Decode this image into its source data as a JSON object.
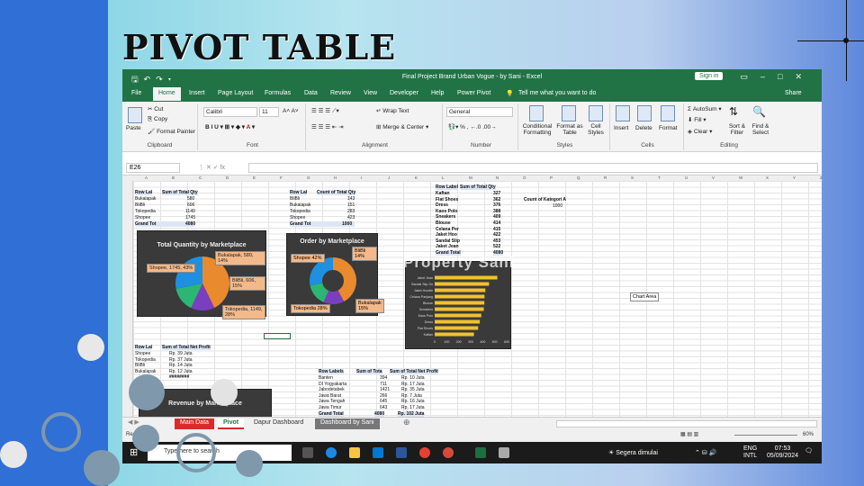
{
  "slide": {
    "title": "PIVOT TABLE",
    "watermark": "Property Sani"
  },
  "window": {
    "title": "Final Project Brand Urban Vogue - by Sani  -  Excel",
    "sign_in": "Sign in",
    "share": "Share"
  },
  "tabs": [
    "File",
    "Home",
    "Insert",
    "Page Layout",
    "Formulas",
    "Data",
    "Review",
    "View",
    "Developer",
    "Help",
    "Power Pivot"
  ],
  "tell_me": "Tell me what you want to do",
  "ribbon": {
    "clipboard": {
      "label": "Clipboard",
      "paste": "Paste",
      "cut": "Cut",
      "copy": "Copy",
      "format_painter": "Format Painter"
    },
    "font": {
      "label": "Font",
      "name": "Calibri",
      "size": "11"
    },
    "alignment": {
      "label": "Alignment",
      "wrap": "Wrap Text",
      "merge": "Merge & Center"
    },
    "number": {
      "label": "Number",
      "format": "General"
    },
    "styles": {
      "label": "Styles",
      "conditional": "Conditional Formatting",
      "format_table": "Format as Table",
      "cell_styles": "Cell Styles"
    },
    "cells": {
      "label": "Cells",
      "insert": "Insert",
      "delete": "Delete",
      "format": "Format"
    },
    "editing": {
      "label": "Editing",
      "autosum": "AutoSum",
      "fill": "Fill",
      "clear": "Clear",
      "sort": "Sort & Filter",
      "find": "Find & Select"
    }
  },
  "name_box": "E26",
  "columns": [
    "A",
    "B",
    "C",
    "D",
    "E",
    "F",
    "G",
    "H",
    "I",
    "J",
    "K",
    "L",
    "M",
    "N",
    "O",
    "P",
    "Q",
    "R",
    "S",
    "T",
    "U",
    "V",
    "W",
    "X",
    "Y",
    "Z"
  ],
  "pivot_qty": {
    "headers": [
      "Row Lal",
      "Sum of Total Qty"
    ],
    "rows": [
      [
        "Bukalapak",
        "580"
      ],
      [
        "BliBli",
        "606"
      ],
      [
        "Tokopedia",
        "1149"
      ],
      [
        "Shopee",
        "1745"
      ]
    ],
    "total": [
      "Grand Tot",
      "4080"
    ]
  },
  "pivot_orders": {
    "headers": [
      "Row Lal",
      "Count of Total Qty"
    ],
    "rows": [
      [
        "BliBli",
        "143"
      ],
      [
        "Bukalapak",
        "151"
      ],
      [
        "Tokopedia",
        "283"
      ],
      [
        "Shopee",
        "423"
      ]
    ],
    "total": [
      "Grand Tot",
      "1000"
    ]
  },
  "pivot_products": {
    "headers": [
      "Row Label",
      "Sum of Total Qty"
    ],
    "rows": [
      [
        "Kaftan",
        "327"
      ],
      [
        "Flat Shoes",
        "362"
      ],
      [
        "Dress",
        "376"
      ],
      [
        "Kaos Polo",
        "388"
      ],
      [
        "Sneakers",
        "409"
      ],
      [
        "Blouse",
        "414"
      ],
      [
        "Celana Per",
        "415"
      ],
      [
        "Jaket Hoo",
        "422"
      ],
      [
        "Sandal Slip",
        "453"
      ],
      [
        "Jaket Jean",
        "522"
      ]
    ],
    "total": [
      "Grand Total",
      "4080"
    ]
  },
  "count_kategori": {
    "header": "Count of Kategori A",
    "value": "1000"
  },
  "pivot_profit": {
    "headers": [
      "Row Lal",
      "Sum of Total Net Profit"
    ],
    "rows": [
      [
        "Shopee",
        "Rp. 39 Juta"
      ],
      [
        "Tokopedia",
        "Rp. 37 Juta"
      ],
      [
        "BliBli",
        "Rp. 14 Juta"
      ],
      [
        "Bukalapak",
        "Rp. 12 Juta"
      ]
    ],
    "total": [
      "",
      "########"
    ]
  },
  "pivot_region": {
    "headers": [
      "Row Labels",
      "Sum of Tota",
      "Sum of Total Net Profit"
    ],
    "rows": [
      [
        "Banten",
        "394",
        "Rp. 10 Juta"
      ],
      [
        "DI Yogyakarta",
        "711",
        "Rp. 17 Juta"
      ],
      [
        "Jabodetabek",
        "1421",
        "Rp. 35 Juta"
      ],
      [
        "Jawa Barat",
        "266",
        "Rp. 7 Juta"
      ],
      [
        "Jawa Tengah",
        "645",
        "Rp. 16 Juta"
      ],
      [
        "Jawa Timur",
        "643",
        "Rp. 17 Juta"
      ]
    ],
    "total": [
      "Grand Total",
      "4080",
      "Rp. 102 Juta"
    ]
  },
  "charts": {
    "qty_title": "Total Quantity by Marketplace",
    "qty_labels": {
      "shopee": "Shopee, 1745, 43%",
      "bukalapak": "Bukalapak, 580, 14%",
      "blibli": "BliBli, 606, 15%",
      "tokopedia": "Tokopedia, 1149, 28%"
    },
    "order_title": "Order by Marketplace",
    "order_labels": {
      "shopee": "Shopee 42%",
      "blibli": "BliBli 14%",
      "bukalapak": "Bukalapak 15%",
      "tokopedia": "Tokopedia 28%"
    },
    "revenue_title": "Revenue by Marketplace",
    "chart_area_tip": "Chart Area"
  },
  "chart_data": [
    {
      "type": "pie",
      "title": "Total Quantity by Marketplace",
      "categories": [
        "Shopee",
        "Bukalapak",
        "BliBli",
        "Tokopedia"
      ],
      "values": [
        1745,
        580,
        606,
        1149
      ],
      "colors": [
        "#e98a2e",
        "#7a3fbf",
        "#2bb673",
        "#1f8fe0"
      ]
    },
    {
      "type": "pie",
      "title": "Order by Marketplace",
      "categories": [
        "Shopee",
        "BliBli",
        "Bukalapak",
        "Tokopedia"
      ],
      "values": [
        423,
        143,
        151,
        283
      ],
      "colors": [
        "#e98a2e",
        "#7a3fbf",
        "#2bb673",
        "#1f8fe0"
      ]
    },
    {
      "type": "bar",
      "categories": [
        "Jaket Jean",
        "Sandal Slip On",
        "Jaket Hoodie",
        "Celana Panjang",
        "Blouse",
        "Sneakers",
        "Kaos Polo",
        "Dress",
        "Flat Shoes",
        "Kaftan"
      ],
      "values": [
        522,
        453,
        422,
        415,
        414,
        409,
        388,
        376,
        362,
        327
      ],
      "xticks": [
        "0",
        "100",
        "200",
        "300",
        "400",
        "500",
        "600"
      ],
      "xlim": [
        0,
        600
      ],
      "color": "#f2c12e"
    }
  ],
  "sheets": [
    "Main Data",
    "Pivot",
    "Dapur Dashboard",
    "Dashboard by Sani"
  ],
  "status": {
    "ready": "Ready",
    "zoom": "60%"
  },
  "taskbar": {
    "search": "Type here to search",
    "weather": "Segera dimulai",
    "lang1": "ENG",
    "lang2": "INTL",
    "time": "07:53",
    "date": "05/09/2024"
  }
}
